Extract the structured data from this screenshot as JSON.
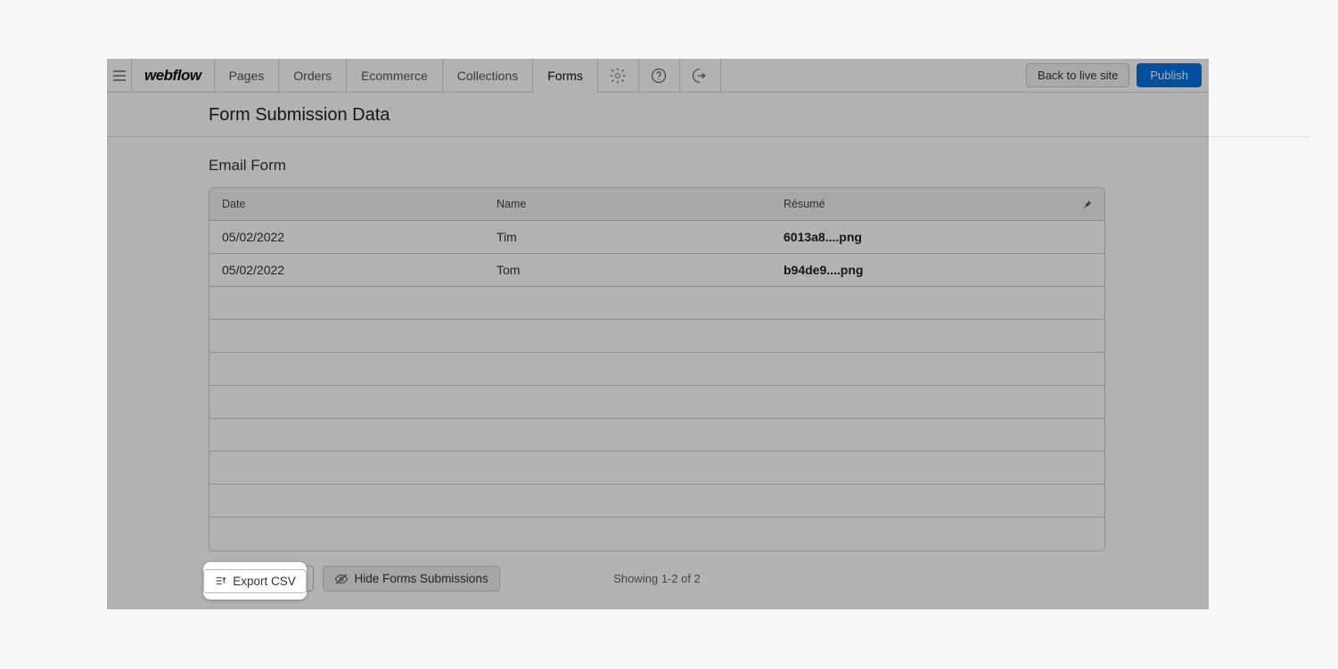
{
  "brand": "webflow",
  "nav": {
    "pages": "Pages",
    "orders": "Orders",
    "ecommerce": "Ecommerce",
    "collections": "Collections",
    "forms": "Forms"
  },
  "actions": {
    "back_to_live": "Back to live site",
    "publish": "Publish"
  },
  "page": {
    "title": "Form Submission Data",
    "form_name": "Email Form"
  },
  "table": {
    "headers": {
      "date": "Date",
      "name": "Name",
      "resume": "Résumé"
    },
    "rows": [
      {
        "date": "05/02/2022",
        "name": "Tim",
        "resume": "6013a8....png"
      },
      {
        "date": "05/02/2022",
        "name": "Tom",
        "resume": "b94de9....png"
      }
    ],
    "empty_row_count": 8
  },
  "footer": {
    "export_csv": "Export CSV",
    "hide_submissions": "Hide Forms Submissions",
    "paging": "Showing 1-2 of 2"
  }
}
